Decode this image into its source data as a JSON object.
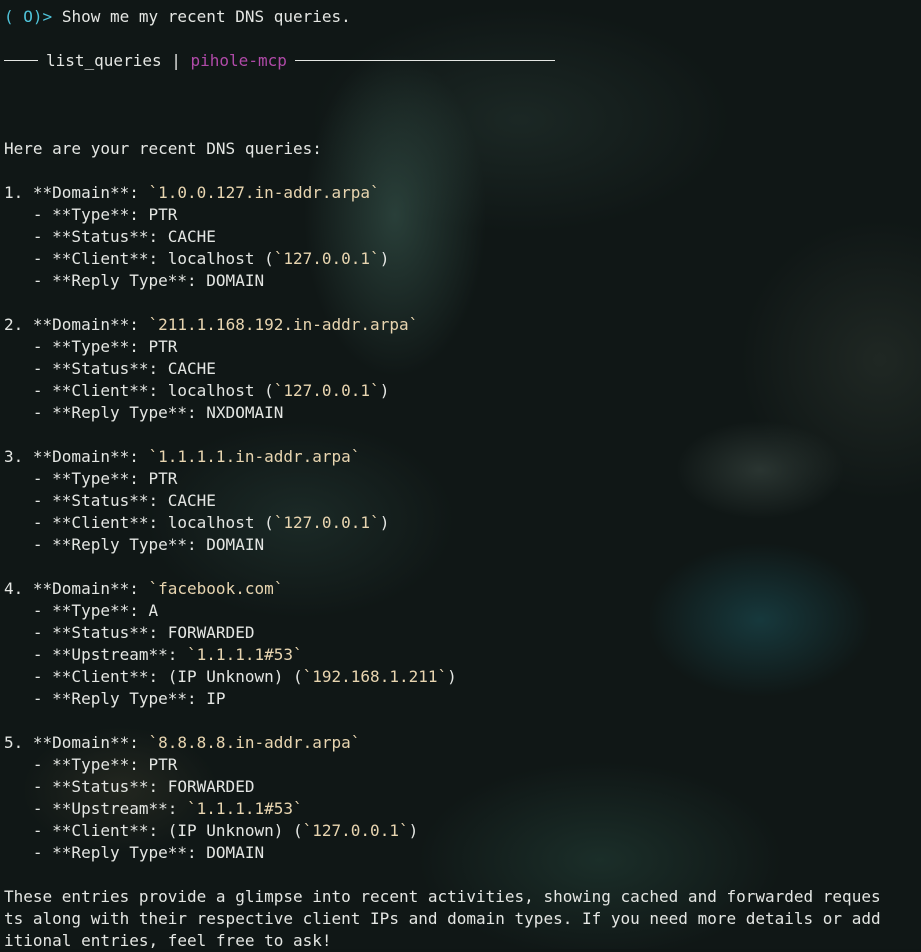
{
  "prompt": {
    "marker": "( O)>",
    "command": "Show me my recent DNS queries."
  },
  "tool_header": {
    "tool": "list_queries",
    "separator": "|",
    "server": "pihole-mcp"
  },
  "intro": "Here are your recent DNS queries:",
  "queries": [
    {
      "domain_line": "1. **Domain**: `1.0.0.127.in-addr.arpa`",
      "details": [
        "   - **Type**: PTR",
        "   - **Status**: CACHE",
        "   - **Client**: localhost (`127.0.0.1`)",
        "   - **Reply Type**: DOMAIN"
      ]
    },
    {
      "domain_line": "2. **Domain**: `211.1.168.192.in-addr.arpa`",
      "details": [
        "   - **Type**: PTR",
        "   - **Status**: CACHE",
        "   - **Client**: localhost (`127.0.0.1`)",
        "   - **Reply Type**: NXDOMAIN"
      ]
    },
    {
      "domain_line": "3. **Domain**: `1.1.1.1.in-addr.arpa`",
      "details": [
        "   - **Type**: PTR",
        "   - **Status**: CACHE",
        "   - **Client**: localhost (`127.0.0.1`)",
        "   - **Reply Type**: DOMAIN"
      ]
    },
    {
      "domain_line": "4. **Domain**: `facebook.com`",
      "details": [
        "   - **Type**: A",
        "   - **Status**: FORWARDED",
        "   - **Upstream**: `1.1.1.1#53`",
        "   - **Client**: (IP Unknown) (`192.168.1.211`)",
        "   - **Reply Type**: IP"
      ]
    },
    {
      "domain_line": "5. **Domain**: `8.8.8.8.in-addr.arpa`",
      "details": [
        "   - **Type**: PTR",
        "   - **Status**: FORWARDED",
        "   - **Upstream**: `1.1.1.1#53`",
        "   - **Client**: (IP Unknown) (`127.0.0.1`)",
        "   - **Reply Type**: DOMAIN"
      ]
    }
  ],
  "closing_lines": [
    "These entries provide a glimpse into recent activities, showing cached and forwarded reques",
    "ts along with their respective client IPs and domain types. If you need more details or add",
    "itional entries, feel free to ask!"
  ],
  "colors": {
    "prompt": "#4fc3d9",
    "server": "#b04aa8",
    "code": "#e8d5b0",
    "text": "#e4e6e3"
  }
}
